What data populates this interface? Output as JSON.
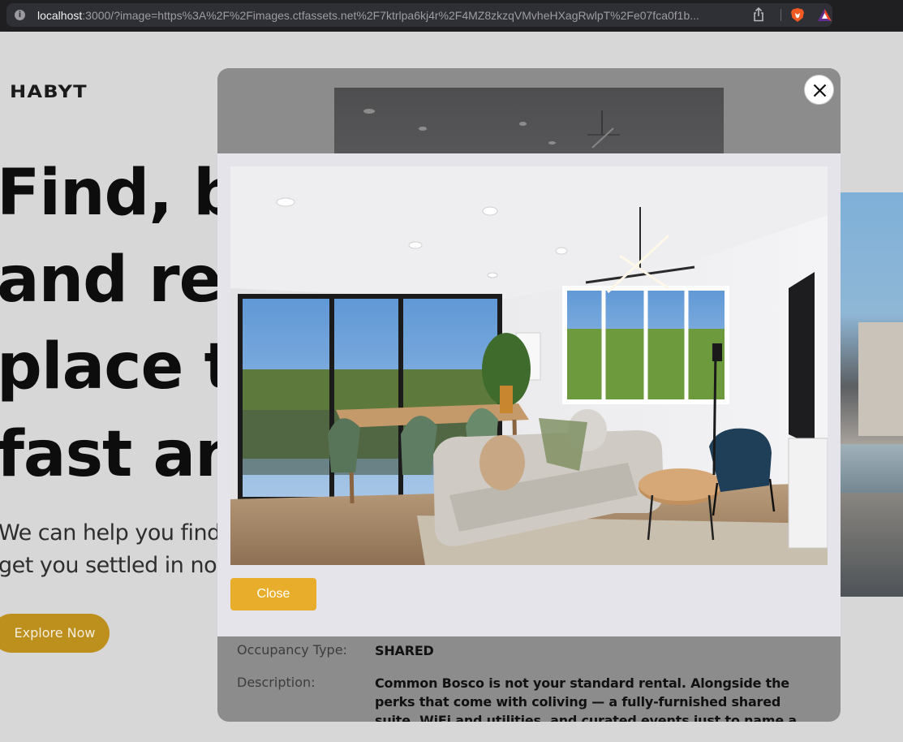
{
  "browser": {
    "url_host": "localhost",
    "url_rest": ":3000/?image=https%3A%2F%2Fimages.ctfassets.net%2F7ktrlpa6kj4r%2F4MZ8zkzqVMvheHXagRwlpT%2Fe07fca0f1b..."
  },
  "background": {
    "logo": "HABYT",
    "hero_lines": [
      "Find, bo",
      "and rent",
      "place to",
      "fast and"
    ],
    "subtitle_lines": [
      "We can help you find w",
      "get you settled in no ti"
    ],
    "explore_label": "Explore Now"
  },
  "modal": {
    "details": [
      {
        "label": "Occupancy Type:",
        "value": "SHARED"
      },
      {
        "label": "Description:",
        "value": "Common Bosco is not your standard rental. Alongside the perks that come with coliving — a fully-furnished shared suite, WiFi and utilities, and curated events just to name a few — Common Bosco is also the city's"
      }
    ]
  },
  "lightbox": {
    "close_label": "Close"
  },
  "colors": {
    "accent": "#e8ae2b",
    "dimmed_accent": "#bd8f1c",
    "lightbox_bg": "#e4e4ea"
  }
}
